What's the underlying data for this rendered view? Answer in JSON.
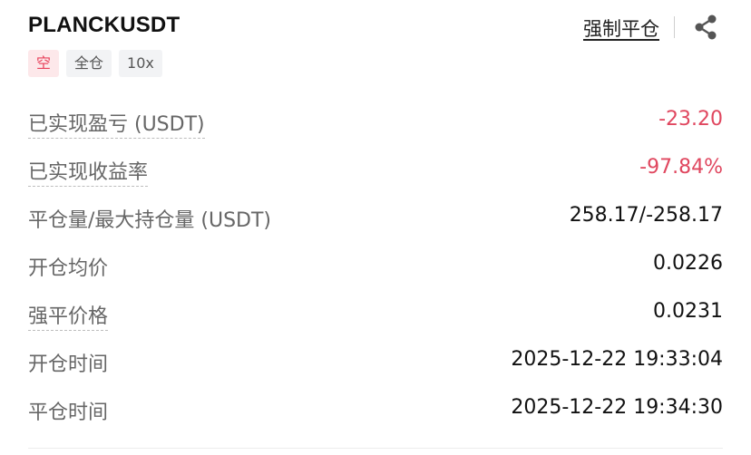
{
  "header": {
    "symbol": "PLANCKUSDT",
    "liquidation_link": "强制平仓",
    "share_icon": "share-icon"
  },
  "tags": {
    "side": "空",
    "margin_mode": "全仓",
    "leverage": "10x"
  },
  "colors": {
    "negative": "#e0475f",
    "short_tag_bg": "#fde8ea",
    "short_tag_text": "#e8425b"
  },
  "details": {
    "realized_pnl": {
      "label": "已实现盈亏 (USDT)",
      "value": "-23.20"
    },
    "realized_roi": {
      "label": "已实现收益率",
      "value": "-97.84%"
    },
    "close_amount": {
      "label": "平仓量/最大持仓量 (USDT)",
      "value": "258.17/-258.17"
    },
    "open_avg_price": {
      "label": "开仓均价",
      "value": "0.0226"
    },
    "liq_price": {
      "label": "强平价格",
      "value": "0.0231"
    },
    "open_time": {
      "label": "开仓时间",
      "value": "2025-12-22 19:33:04"
    },
    "close_time": {
      "label": "平仓时间",
      "value": "2025-12-22 19:34:30"
    }
  }
}
